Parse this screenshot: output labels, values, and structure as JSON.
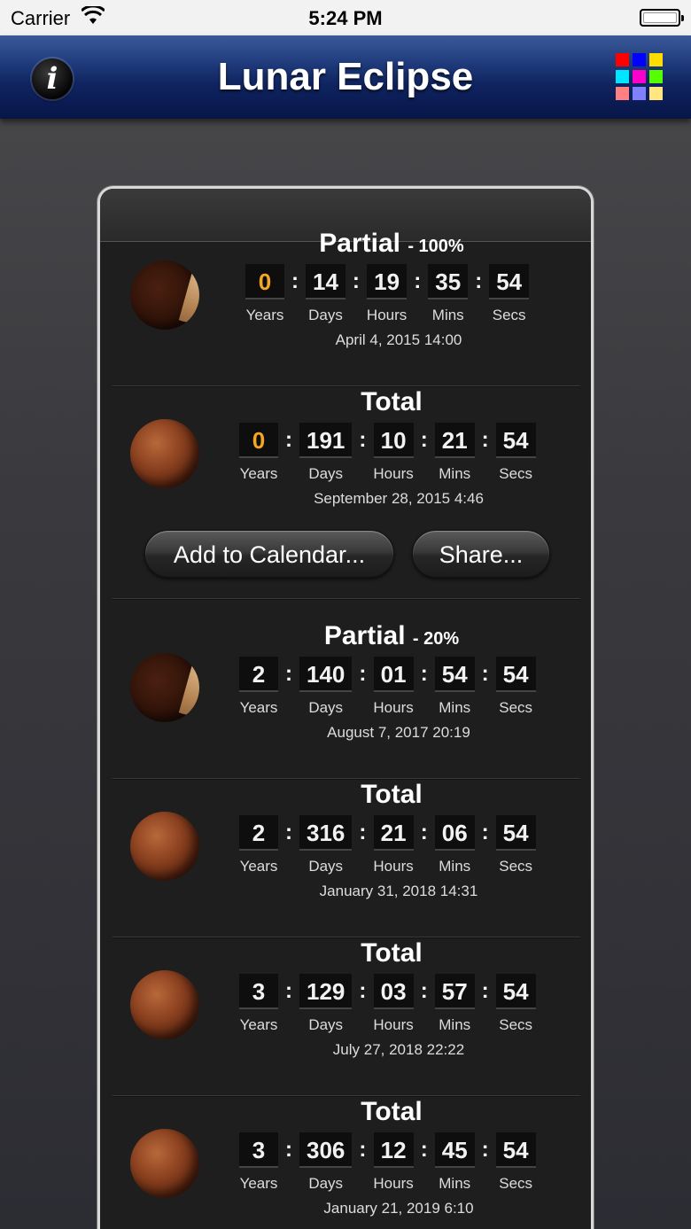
{
  "status_bar": {
    "carrier": "Carrier",
    "time": "5:24 PM"
  },
  "nav": {
    "title": "Lunar Eclipse",
    "info_icon": "i",
    "grid_colors": [
      "#ff0000",
      "#0000ff",
      "#ffdd00",
      "#00e5ff",
      "#ff00cc",
      "#55ff00",
      "#ff8080",
      "#8080ff",
      "#ffe680"
    ]
  },
  "countdown_units": [
    "Years",
    "Days",
    "Hours",
    "Mins",
    "Secs"
  ],
  "eclipses": [
    {
      "type": "Partial",
      "percent": "- 100%",
      "moon": "partial",
      "years": "0",
      "days": "14",
      "hours": "19",
      "mins": "35",
      "secs": "54",
      "date": "April 4, 2015  14:00"
    },
    {
      "type": "Total",
      "percent": "",
      "moon": "total",
      "years": "0",
      "days": "191",
      "hours": "10",
      "mins": "21",
      "secs": "54",
      "date": "September 28, 2015  4:46"
    },
    {
      "type": "Partial",
      "percent": "- 20%",
      "moon": "partial",
      "years": "2",
      "days": "140",
      "hours": "01",
      "mins": "54",
      "secs": "54",
      "date": "August 7, 2017  20:19"
    },
    {
      "type": "Total",
      "percent": "",
      "moon": "total",
      "years": "2",
      "days": "316",
      "hours": "21",
      "mins": "06",
      "secs": "54",
      "date": "January 31, 2018  14:31"
    },
    {
      "type": "Total",
      "percent": "",
      "moon": "total",
      "years": "3",
      "days": "129",
      "hours": "03",
      "mins": "57",
      "secs": "54",
      "date": "July 27, 2018  22:22"
    },
    {
      "type": "Total",
      "percent": "",
      "moon": "total",
      "years": "3",
      "days": "306",
      "hours": "12",
      "mins": "45",
      "secs": "54",
      "date": "January 21, 2019  6:10"
    }
  ],
  "actions": {
    "add_to_calendar": "Add to Calendar...",
    "share": "Share..."
  }
}
